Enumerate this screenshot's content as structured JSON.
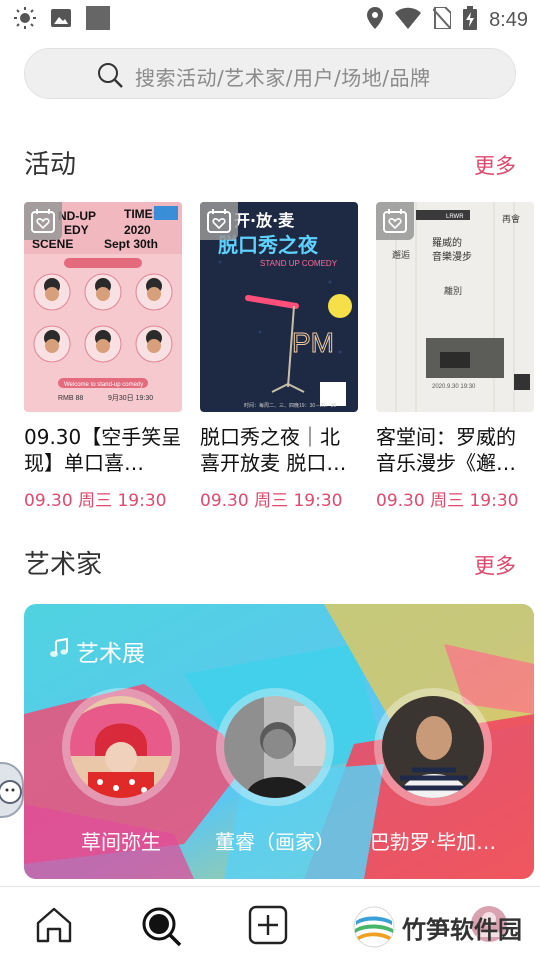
{
  "status_bar": {
    "time": "8:49"
  },
  "search": {
    "placeholder": "搜索活动/艺术家/用户/场地/品牌"
  },
  "events_section": {
    "title": "活动",
    "more": "更多",
    "items": [
      {
        "title": "09.30【空手笑呈现】单口喜…",
        "time": "09.30 周三 19:30",
        "poster_text": [
          "ND-UP",
          "TIME:",
          "EDY",
          "2020",
          "SCENE",
          "Sept 30th",
          "RMB 88",
          "9月30日 19:30",
          "Welcome to stand-up comedy"
        ]
      },
      {
        "title": "脱口秀之夜｜北喜开放麦 脱口…",
        "time": "09.30 周三 19:30",
        "poster_text": [
          "开·放·麦",
          "脱口秀之夜",
          "STAND UP COMEDY",
          "PM",
          "时间：每周二、三、四晚19：30－21：30"
        ]
      },
      {
        "title": "客堂间：罗威的音乐漫步《邂…",
        "time": "09.30 周三 19:30",
        "poster_text": [
          "LRWR",
          "羅威的",
          "音樂漫步",
          "邂逅",
          "離別",
          "再會",
          "2020.9.30 19:30"
        ]
      }
    ]
  },
  "artists_section": {
    "title": "艺术家",
    "more": "更多",
    "banner_tag": "艺术展",
    "artists": [
      {
        "name": "草间弥生"
      },
      {
        "name": "董睿（画家）"
      },
      {
        "name": "巴勃罗·毕加…"
      }
    ]
  },
  "watermark": {
    "text": "竹笋软件园"
  },
  "colors": {
    "accent": "#e0486d",
    "search_bg": "#efefef"
  },
  "icons": {
    "status_left": [
      "brightness-icon",
      "image-icon",
      "square-icon"
    ],
    "status_right": [
      "location-icon",
      "wifi-icon",
      "no-sim-icon",
      "battery-charging-icon"
    ],
    "nav": [
      "home-icon",
      "discover-icon",
      "add-icon",
      "profile-icon"
    ]
  }
}
